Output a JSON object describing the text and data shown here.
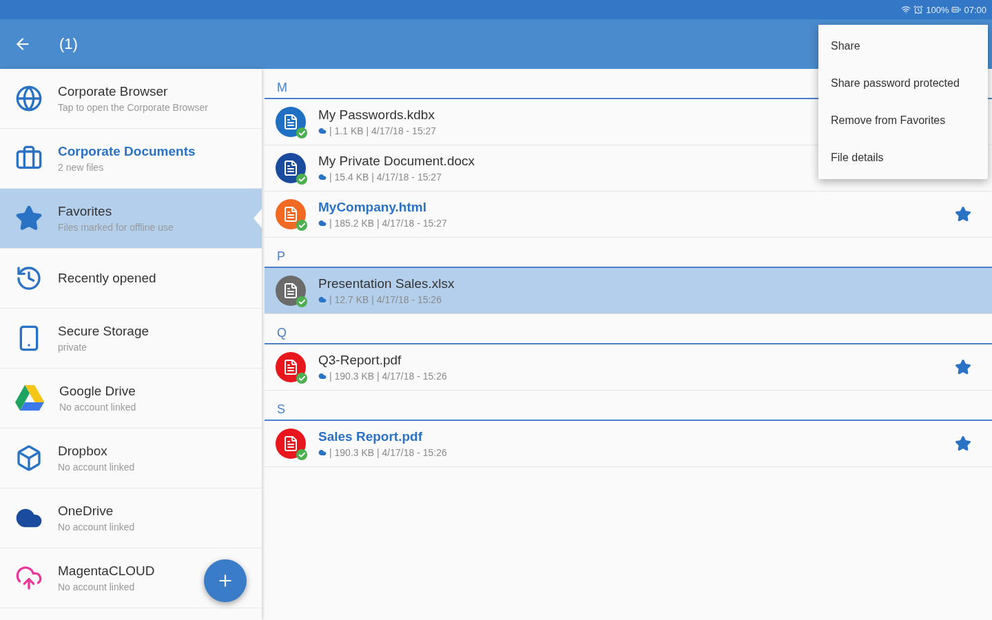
{
  "status_bar": {
    "battery": "100%",
    "time": "07:00"
  },
  "toolbar": {
    "title": "(1)"
  },
  "sidebar": {
    "items": [
      {
        "title": "Corporate Browser",
        "subtitle": "Tap to open the Corporate Browser",
        "selected": false,
        "highlighted": false
      },
      {
        "title": "Corporate Documents",
        "subtitle": "2 new files",
        "selected": false,
        "highlighted": true
      },
      {
        "title": "Favorites",
        "subtitle": "Files marked for offline use",
        "selected": true,
        "highlighted": false
      },
      {
        "title": "Recently opened",
        "selected": false,
        "highlighted": false
      },
      {
        "title": "Secure Storage",
        "subtitle": "private",
        "selected": false,
        "highlighted": false
      },
      {
        "title": "Google Drive",
        "subtitle": "No account linked",
        "selected": false,
        "highlighted": false
      },
      {
        "title": "Dropbox",
        "subtitle": "No account linked",
        "selected": false,
        "highlighted": false
      },
      {
        "title": "OneDrive",
        "subtitle": "No account linked",
        "selected": false,
        "highlighted": false
      },
      {
        "title": "MagentaCLOUD",
        "subtitle": "No account linked",
        "selected": false,
        "highlighted": false
      }
    ]
  },
  "file_list": {
    "sections": [
      {
        "letter": "M",
        "files": [
          {
            "name": "My Passwords.kdbx",
            "meta": "| 1.1 KB | 4/17/18 - 15:27",
            "color": "#1f6fc2",
            "favorite": false,
            "selected": false,
            "highlighted": false
          },
          {
            "name": "My Private Document.docx",
            "meta": "| 15.4 KB | 4/17/18 - 15:27",
            "color": "#1b4b9c",
            "favorite": false,
            "selected": false,
            "highlighted": false
          },
          {
            "name": "MyCompany.html",
            "meta": "| 185.2 KB | 4/17/18 - 15:27",
            "color": "#f06a24",
            "favorite": true,
            "selected": false,
            "highlighted": true
          }
        ]
      },
      {
        "letter": "P",
        "files": [
          {
            "name": "Presentation Sales.xlsx",
            "meta": "| 12.7 KB | 4/17/18 - 15:26",
            "color": "#6b6b6b",
            "favorite": false,
            "selected": true,
            "highlighted": false
          }
        ]
      },
      {
        "letter": "Q",
        "files": [
          {
            "name": "Q3-Report.pdf",
            "meta": "| 190.3 KB | 4/17/18 - 15:26",
            "color": "#e8161d",
            "favorite": true,
            "selected": false,
            "highlighted": false
          }
        ]
      },
      {
        "letter": "S",
        "files": [
          {
            "name": "Sales Report.pdf",
            "meta": "| 190.3 KB | 4/17/18 - 15:26",
            "color": "#e8161d",
            "favorite": true,
            "selected": false,
            "highlighted": true
          }
        ]
      }
    ]
  },
  "menu": {
    "items": [
      "Share",
      "Share password protected",
      "Remove from Favorites",
      "File details"
    ]
  }
}
